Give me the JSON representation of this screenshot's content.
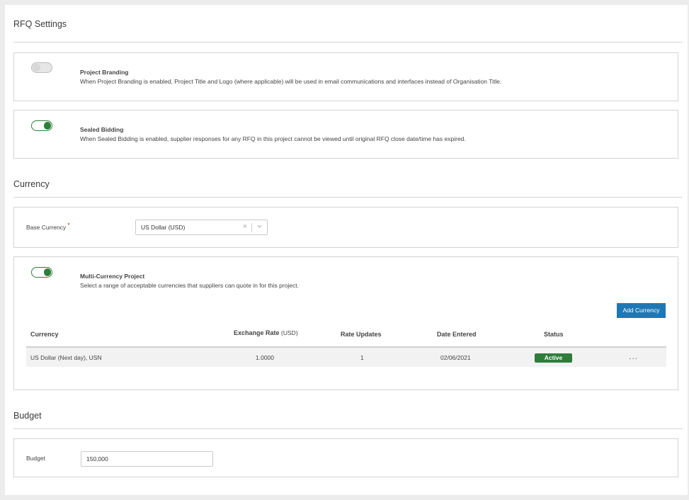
{
  "rfq_settings": {
    "title": "RFQ Settings",
    "project_branding": {
      "title": "Project Branding",
      "description": "When Project Branding is enabled, Project Title and Logo (where applicable) will be used in email communications and interfaces instead of Organisation Title.",
      "enabled": false
    },
    "sealed_bidding": {
      "title": "Sealed Bidding",
      "description": "When Sealed Bidding is enabled, supplier responses for any RFQ in this project cannot be viewed until original RFQ close date/time has expired.",
      "enabled": true
    }
  },
  "currency": {
    "title": "Currency",
    "base_currency_label": "Base Currency",
    "required_mark": "*",
    "base_currency_value": "US Dollar (USD)",
    "clear_glyph": "×",
    "multi_currency": {
      "title": "Multi-Currency Project",
      "description": "Select a range of acceptable currencies that suppliers can quote in for this project.",
      "enabled": true,
      "add_button": "Add Currency",
      "columns": {
        "currency": "Currency",
        "exchange_rate": "Exchange Rate",
        "exchange_rate_unit": "(USD)",
        "rate_updates": "Rate Updates",
        "date_entered": "Date Entered",
        "status": "Status"
      },
      "rows": [
        {
          "currency": "US Dollar (Next day), USN",
          "exchange_rate": "1.0000",
          "rate_updates": "1",
          "date_entered": "02/06/2021",
          "status": "Active",
          "menu": "..."
        }
      ]
    }
  },
  "budget": {
    "title": "Budget",
    "label": "Budget",
    "value": "150,000"
  },
  "colors": {
    "toggle_on": "#2e7d3a",
    "primary_button": "#1f78b4",
    "status_active": "#2e7d3a",
    "required": "#c0392b"
  }
}
